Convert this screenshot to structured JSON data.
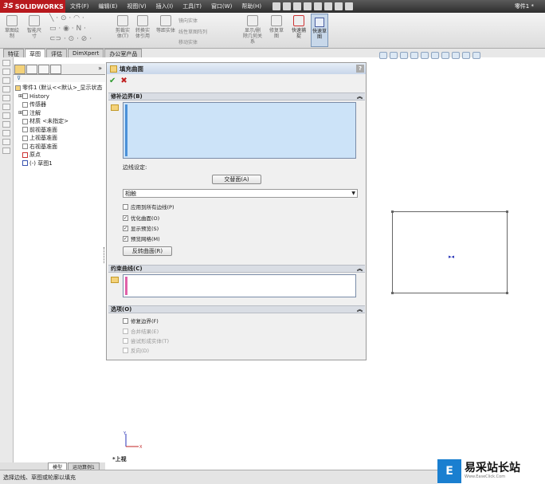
{
  "titlebar": {
    "brand": "SOLIDWORKS",
    "menus": [
      "文件(F)",
      "编辑(E)",
      "视图(V)",
      "插入(I)",
      "工具(T)",
      "窗口(W)",
      "帮助(H)"
    ],
    "doc_title": "零件1 *"
  },
  "ribbon": {
    "buttons": [
      {
        "label": "草图绘制"
      },
      {
        "label": "智能尺寸"
      },
      {
        "label": "剪裁实体(T)"
      },
      {
        "label": "转换实体引用"
      },
      {
        "label": "等距实体"
      },
      {
        "label": "显示/删除几何关系"
      },
      {
        "label": "修复草图"
      },
      {
        "label": "快速捕捉"
      },
      {
        "label": "快速草图"
      }
    ],
    "small_items": [
      "镜向实体",
      "线性草图阵列",
      "移动实体"
    ]
  },
  "tabs": [
    "特征",
    "草图",
    "评估",
    "DimXpert",
    "办公室产品"
  ],
  "feature_tree": {
    "items": [
      {
        "label": "零件1 (默认<<默认>_显示状态"
      },
      {
        "label": "History"
      },
      {
        "label": "传感器"
      },
      {
        "label": "注解"
      },
      {
        "label": "材质 <未指定>"
      },
      {
        "label": "前视基准面"
      },
      {
        "label": "上视基准面"
      },
      {
        "label": "右视基准面"
      },
      {
        "label": "原点"
      },
      {
        "label": "(-) 草图1"
      }
    ]
  },
  "bottom_tabs": [
    "模型",
    "运动算例1"
  ],
  "status_text": "选择边线、草图或轮廓以填充",
  "panel": {
    "title": "填充曲面",
    "sections": {
      "patch": "修补边界(B)",
      "constraint": "约束曲线(C)",
      "options": "选项(O)"
    },
    "edge_settings_label": "边线设定:",
    "alternate_face_button": "交替面(A)",
    "tangent_select": "相触",
    "apply_all": "应用到所有边线(P)",
    "optimize": "优化曲面(O)",
    "show_preview": "显示预览(S)",
    "preview_mesh": "预览网格(M)",
    "reverse_button": "反转曲面(R)",
    "options": {
      "fix_boundary": "修复边界(F)",
      "merge_result": "合并结果(E)",
      "try_solid": "尝试形成实体(T)",
      "reverse": "反向(D)"
    }
  },
  "canvas": {
    "view_label": "*上视",
    "axis_x": "X",
    "axis_y": "Y"
  },
  "watermark": {
    "text": "易采站长站",
    "sub": "Www.EaseClick.Com"
  },
  "colors": {
    "brand_red": "#b8191e",
    "selection_blue": "#cce3f8",
    "origin_blue": "#2a36b8"
  }
}
